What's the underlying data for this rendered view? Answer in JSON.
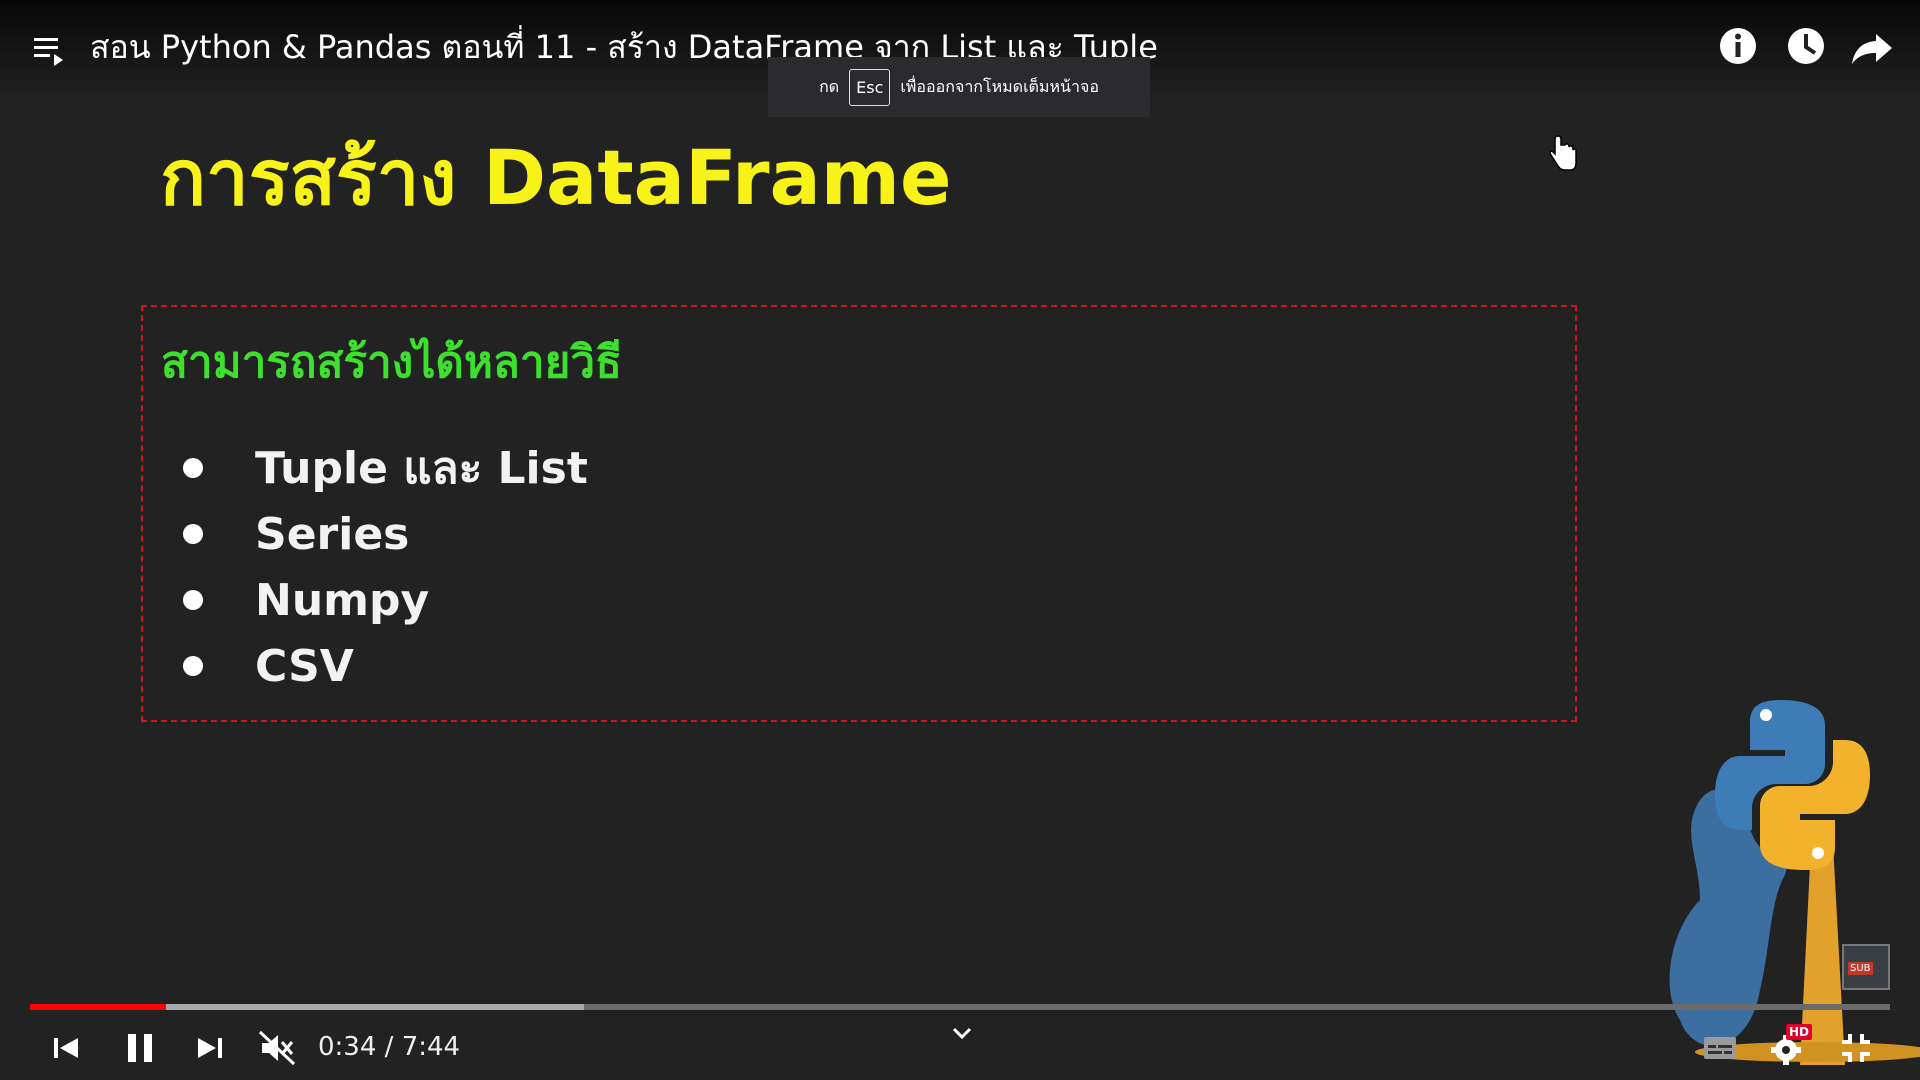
{
  "header": {
    "title": "สอน Python & Pandas ตอนที่ 11 - สร้าง DataFrame จาก List และ Tuple"
  },
  "toast": {
    "prefix": "กด",
    "key": "Esc",
    "suffix": "เพื่อออกจากโหมดเต็มหน้าจอ"
  },
  "slide": {
    "title": "การสร้าง DataFrame",
    "heading": "สามารถสร้างได้หลายวิธี",
    "bullets": [
      "Tuple และ List",
      "Series",
      "Numpy",
      "CSV"
    ]
  },
  "player": {
    "time_current": "0:34",
    "time_separator": " / ",
    "time_total": "7:44",
    "played_fraction": 0.073,
    "buffered_fraction": 0.298,
    "quality_badge": "HD",
    "sub_badge": "SUB"
  },
  "colors": {
    "progress_played": "#ff0000",
    "slide_title": "#f7f318",
    "slide_heading": "#3ee02e",
    "box_border": "#d0141c"
  }
}
